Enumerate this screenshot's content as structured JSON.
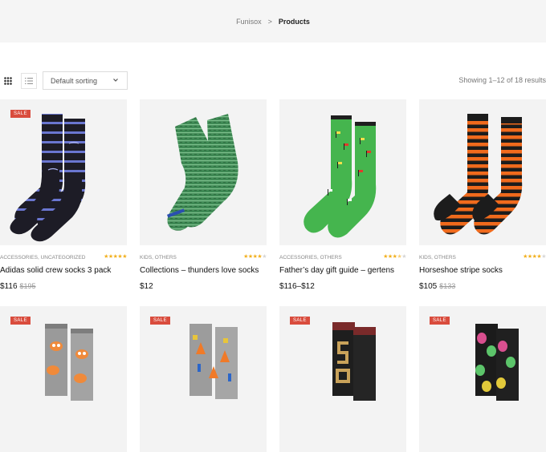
{
  "breadcrumb": {
    "home": "Funisox",
    "separator": ">",
    "current": "Products"
  },
  "toolbar": {
    "sort_value": "Default sorting",
    "result_count": "Showing 1–12 of 18 results"
  },
  "colors": {
    "sale": "#d94c3d",
    "star": "#f2b01e"
  },
  "products": [
    {
      "sale": true,
      "sale_label": "SALE",
      "categories": "ACCESSORIES, UNCATEGORIZED",
      "rating": 5,
      "title": "Adidas solid crew socks 3 pack",
      "price": "$116",
      "old_price": "$195",
      "image": "navy-blue-striped-socks"
    },
    {
      "sale": false,
      "categories": "KIDS, OTHERS",
      "rating": 4,
      "title": "Collections – thunders love socks",
      "price": "$12",
      "old_price": "",
      "image": "green-heather-socks"
    },
    {
      "sale": false,
      "categories": "ACCESSORIES, OTHERS",
      "rating": 3.5,
      "title": "Father’s day gift guide – gertens",
      "price": "$116–$12",
      "old_price": "",
      "image": "green-golf-flag-socks"
    },
    {
      "sale": false,
      "categories": "KIDS, OTHERS",
      "rating": 4,
      "title": "Horseshoe stripe socks",
      "price": "$105",
      "old_price": "$133",
      "image": "orange-black-striped-socks"
    },
    {
      "sale": true,
      "sale_label": "SALE",
      "categories": "",
      "rating": 0,
      "title": "",
      "price": "",
      "old_price": "",
      "image": "grey-owl-print-socks"
    },
    {
      "sale": true,
      "sale_label": "SALE",
      "categories": "",
      "rating": 0,
      "title": "",
      "price": "",
      "old_price": "",
      "image": "grey-traffic-cone-socks"
    },
    {
      "sale": true,
      "sale_label": "SALE",
      "categories": "",
      "rating": 0,
      "title": "",
      "price": "",
      "old_price": "",
      "image": "black-letter-socks"
    },
    {
      "sale": true,
      "sale_label": "SALE",
      "categories": "",
      "rating": 0,
      "title": "",
      "price": "",
      "old_price": "",
      "image": "black-luchador-mask-socks"
    }
  ]
}
